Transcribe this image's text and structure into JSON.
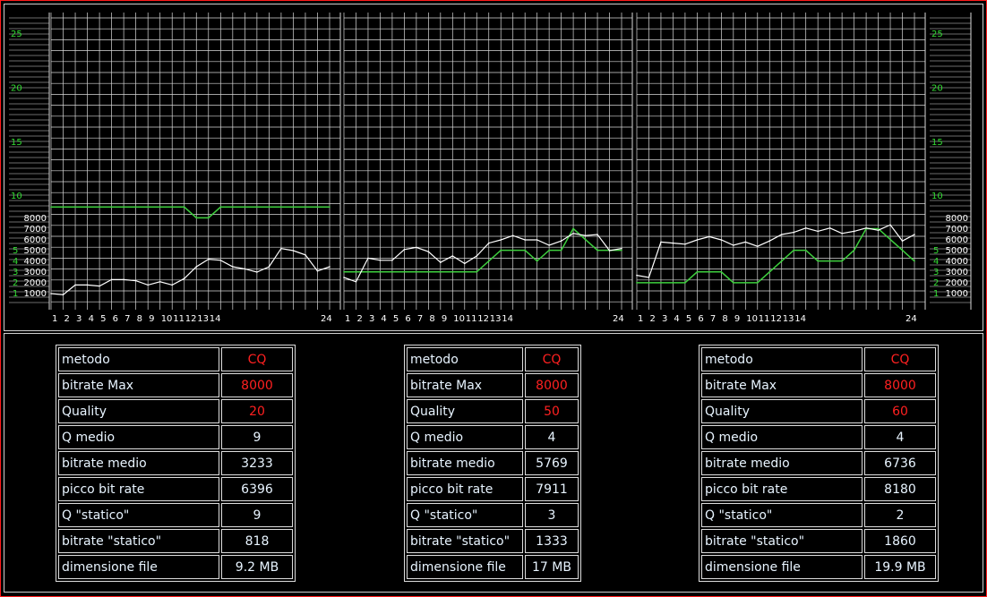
{
  "colors": {
    "grid": "#d8d8d8",
    "bitrate_line": "#ffffff",
    "quality_line": "#3ecf3e",
    "axis_text": "#33dd33",
    "highlight": "#ff2020",
    "text": "#e8f4ff",
    "frame": "#ff1a1a"
  },
  "y_axis": {
    "quality_ticks": [
      10,
      15,
      20,
      25
    ],
    "bitrate_ticks": [
      {
        "value": 1000,
        "label": "1000"
      },
      {
        "value": 2000,
        "label": "2000"
      },
      {
        "value": 3000,
        "label": "3000"
      },
      {
        "value": 4000,
        "label": "4000"
      },
      {
        "value": 5000,
        "label": "5000"
      },
      {
        "value": 6000,
        "label": "6000"
      },
      {
        "value": 7000,
        "label": "7000"
      },
      {
        "value": 8000,
        "label": "8000"
      }
    ],
    "small_ticks": [
      "1",
      "2",
      "3",
      "4",
      "5"
    ]
  },
  "x_axis": {
    "labels": [
      "1",
      "2",
      "3",
      "4",
      "5",
      "6",
      "7",
      "8",
      "9",
      "10",
      "11",
      "12",
      "13",
      "14",
      "24"
    ]
  },
  "chart_data": [
    {
      "type": "line",
      "x": [
        1,
        2,
        3,
        4,
        5,
        6,
        7,
        8,
        9,
        10,
        11,
        12,
        13,
        14,
        15,
        16,
        17,
        18,
        19,
        20,
        21,
        22,
        23,
        24
      ],
      "series": [
        {
          "axis": "bitrate",
          "values": [
            1000,
            900,
            1800,
            1800,
            1700,
            2300,
            2300,
            2200,
            1800,
            2100,
            1800,
            2400,
            3500,
            4200,
            4100,
            3500,
            3300,
            3000,
            3500,
            5200,
            5000,
            4600,
            3100,
            3500
          ]
        },
        {
          "axis": "quality",
          "values": [
            9,
            9,
            9,
            9,
            9,
            9,
            9,
            9,
            9,
            9,
            9,
            9,
            8,
            8,
            9,
            9,
            9,
            9,
            9,
            9,
            9,
            9,
            9,
            9
          ]
        }
      ],
      "ylim_quality": [
        0,
        27
      ],
      "ylim_bitrate": [
        0,
        8000
      ],
      "grid": true
    },
    {
      "type": "line",
      "x": [
        1,
        2,
        3,
        4,
        5,
        6,
        7,
        8,
        9,
        10,
        11,
        12,
        13,
        14,
        15,
        16,
        17,
        18,
        19,
        20,
        21,
        22,
        23,
        24
      ],
      "series": [
        {
          "axis": "bitrate",
          "values": [
            2500,
            2100,
            4300,
            4100,
            4100,
            5100,
            5300,
            4900,
            3900,
            4500,
            3800,
            4500,
            5700,
            6000,
            6400,
            6000,
            6000,
            5500,
            5900,
            6600,
            6400,
            6500,
            5000,
            5200
          ]
        },
        {
          "axis": "quality",
          "values": [
            3,
            3,
            3,
            3,
            3,
            3,
            3,
            3,
            3,
            3,
            3,
            3,
            4,
            5,
            5,
            5,
            4,
            5,
            5,
            7,
            6,
            5,
            5,
            5
          ]
        }
      ],
      "ylim_quality": [
        0,
        27
      ],
      "ylim_bitrate": [
        0,
        8000
      ],
      "grid": true
    },
    {
      "type": "line",
      "x": [
        1,
        2,
        3,
        4,
        5,
        6,
        7,
        8,
        9,
        10,
        11,
        12,
        13,
        14,
        15,
        16,
        17,
        18,
        19,
        20,
        21,
        22,
        23,
        24
      ],
      "series": [
        {
          "axis": "bitrate",
          "values": [
            2700,
            2500,
            5800,
            5700,
            5600,
            6000,
            6300,
            6000,
            5500,
            5800,
            5400,
            5900,
            6500,
            6700,
            7100,
            6800,
            7100,
            6600,
            6800,
            7100,
            6900,
            7400,
            5900,
            6500
          ]
        },
        {
          "axis": "quality",
          "values": [
            2,
            2,
            2,
            2,
            2,
            3,
            3,
            3,
            2,
            2,
            2,
            3,
            4,
            5,
            5,
            4,
            4,
            4,
            5,
            7,
            7,
            6,
            5,
            4
          ]
        }
      ],
      "ylim_quality": [
        0,
        27
      ],
      "ylim_bitrate": [
        0,
        8000
      ],
      "grid": true
    }
  ],
  "tables": [
    {
      "rows": [
        {
          "label": "metodo",
          "value": "CQ",
          "highlight": true
        },
        {
          "label": "bitrate Max",
          "value": "8000",
          "highlight": true
        },
        {
          "label": "Quality",
          "value": "20",
          "highlight": true
        },
        {
          "label": "Q medio",
          "value": "9"
        },
        {
          "label": "bitrate medio",
          "value": "3233"
        },
        {
          "label": "picco bit rate",
          "value": "6396"
        },
        {
          "label": "Q \"statico\"",
          "value": "9"
        },
        {
          "label": "bitrate \"statico\"",
          "value": "818"
        },
        {
          "label": "dimensione file",
          "value": "9.2 MB"
        }
      ]
    },
    {
      "rows": [
        {
          "label": "metodo",
          "value": "CQ",
          "highlight": true
        },
        {
          "label": "bitrate Max",
          "value": "8000",
          "highlight": true
        },
        {
          "label": "Quality",
          "value": "50",
          "highlight": true
        },
        {
          "label": "Q medio",
          "value": "4"
        },
        {
          "label": "bitrate medio",
          "value": "5769"
        },
        {
          "label": "picco bit rate",
          "value": "7911"
        },
        {
          "label": "Q \"statico\"",
          "value": "3"
        },
        {
          "label": "bitrate \"statico\"",
          "value": "1333"
        },
        {
          "label": "dimensione file",
          "value": "17 MB"
        }
      ]
    },
    {
      "rows": [
        {
          "label": "metodo",
          "value": "CQ",
          "highlight": true
        },
        {
          "label": "bitrate Max",
          "value": "8000",
          "highlight": true
        },
        {
          "label": "Quality",
          "value": "60",
          "highlight": true
        },
        {
          "label": "Q medio",
          "value": "4"
        },
        {
          "label": "bitrate medio",
          "value": "6736"
        },
        {
          "label": "picco bit rate",
          "value": "8180"
        },
        {
          "label": "Q \"statico\"",
          "value": "2"
        },
        {
          "label": "bitrate \"statico\"",
          "value": "1860"
        },
        {
          "label": "dimensione file",
          "value": "19.9 MB"
        }
      ]
    }
  ]
}
